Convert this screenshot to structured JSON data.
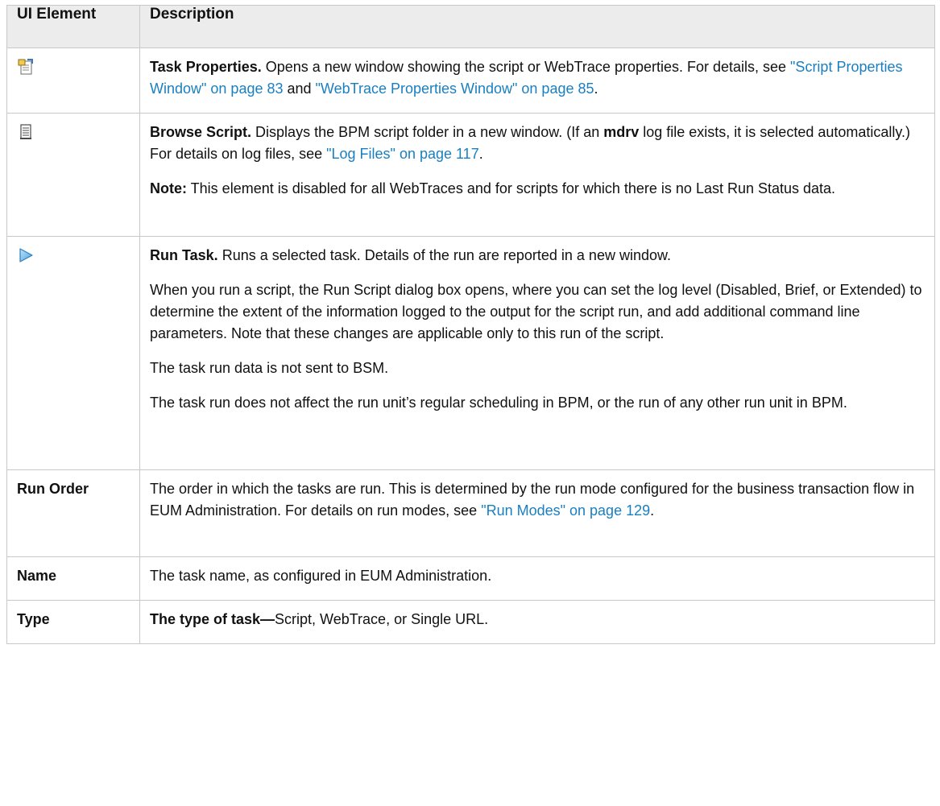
{
  "header": {
    "col_element": "UI Element",
    "col_description": "Description"
  },
  "rows": {
    "task_properties": {
      "icon": "task-properties-icon",
      "bold": "Task Properties.",
      "t1": " Opens a new window showing the script or WebTrace properties. For details, see ",
      "link1": "\"Script Properties Window\" on page 83",
      "t2": " and ",
      "link2": "\"WebTrace Properties Window\" on page 85",
      "t3": "."
    },
    "browse_script": {
      "icon": "browse-script-icon",
      "bold": "Browse Script.",
      "t1": " Displays the BPM script folder in a new window. (If an ",
      "bold2": "mdrv",
      "t2": " log file exists, it is selected automatically.) For details on log files, see ",
      "link1": "\"Log Files\" on page 117",
      "t3": ".",
      "note_label": "Note:",
      "note_text": " This element is disabled for all WebTraces and for scripts for which there is no Last Run Status data."
    },
    "run_task": {
      "icon": "run-task-icon",
      "bold": "Run Task.",
      "t1": " Runs a selected task. Details of the run are reported in a new window.",
      "p2": "When you run a script, the Run Script dialog box opens, where you can set the log level (Disabled, Brief, or Extended) to determine the extent of the information logged to the output for the script run, and add additional command line parameters. Note that these changes are applicable only to this run of the script.",
      "p3": "The task run data is not sent to BSM.",
      "p4": "The task run does not affect the run unit’s regular scheduling in BPM, or the run of any other run unit in BPM."
    },
    "run_order": {
      "label": "Run Order",
      "t1": "The order in which the tasks are run. This is determined by the run mode configured for the business transaction flow in EUM Administration. For details on run modes, see ",
      "link1": "\"Run Modes\" on page 129",
      "t2": "."
    },
    "name": {
      "label": "Name",
      "t1": "The task name, as configured in EUM Administration."
    },
    "type": {
      "label": "Type",
      "bold": "The type of task—",
      "t1": "Script, WebTrace, or Single URL."
    }
  },
  "colors": {
    "link": "#1a7fc1",
    "header_bg": "#ececec",
    "border": "#c8c8c8"
  }
}
